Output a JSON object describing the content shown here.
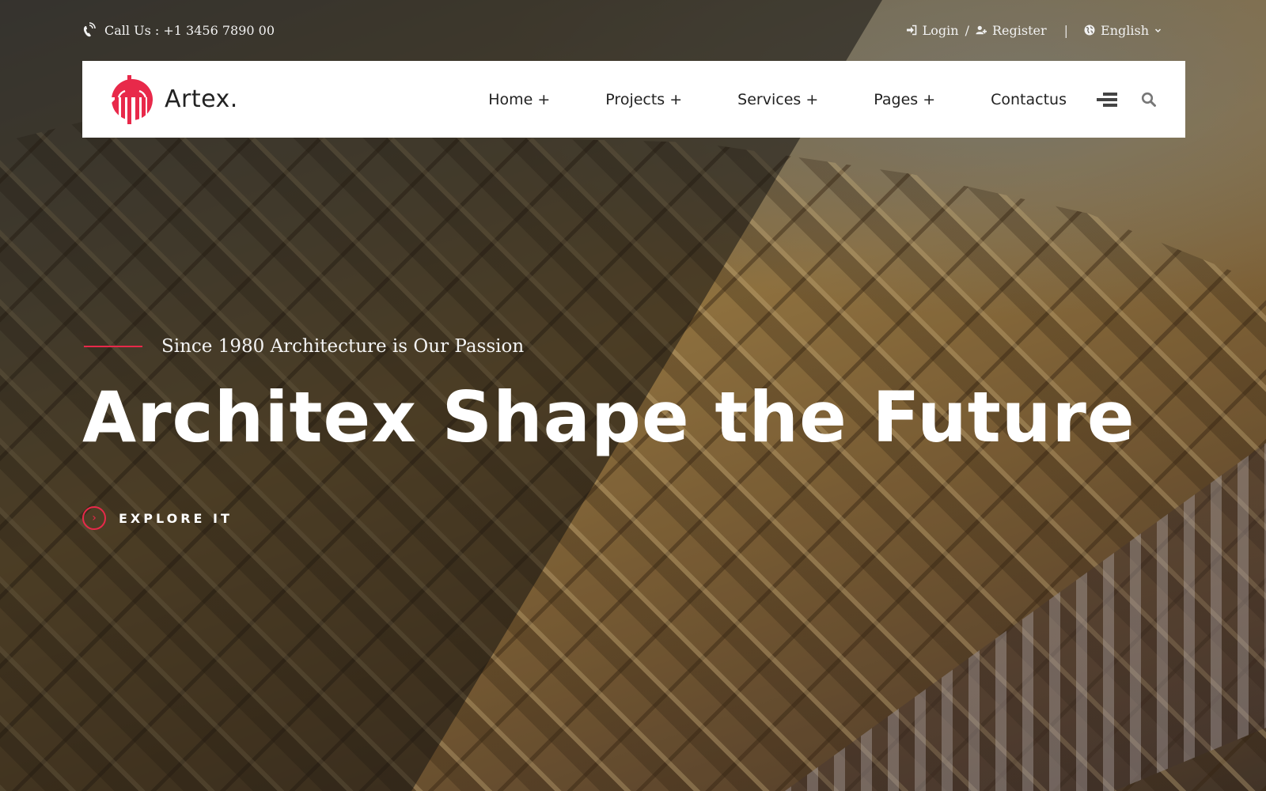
{
  "colors": {
    "accent": "#e8294a",
    "nav_bg": "#ffffff",
    "nav_text": "#222222",
    "hero_text": "#ffffff"
  },
  "topbar": {
    "phone_icon": "phone-ringing-icon",
    "phone_text": "Call Us : +1 3456 7890 00",
    "login_icon": "sign-in-icon",
    "login_label": "Login",
    "separator": "/",
    "register_icon": "user-plus-icon",
    "register_label": "Register",
    "divider": "|",
    "language_icon": "globe-icon",
    "language_selected": "English",
    "language_chevron": "chevron-down-icon"
  },
  "brand": {
    "name": "Artex.",
    "logo_icon": "building-circle-logo"
  },
  "nav": {
    "items": [
      {
        "label": "Home +"
      },
      {
        "label": "Projects +"
      },
      {
        "label": "Services +"
      },
      {
        "label": "Pages +"
      },
      {
        "label": "Contactus"
      }
    ],
    "menu_icon": "hamburger-menu-icon",
    "search_icon": "search-icon"
  },
  "hero": {
    "tagline": "Since 1980 Architecture is Our Passion",
    "headline": "Architex Shape the Future",
    "cta_label": "EXPLORE IT",
    "cta_icon": "chevron-right-icon"
  }
}
